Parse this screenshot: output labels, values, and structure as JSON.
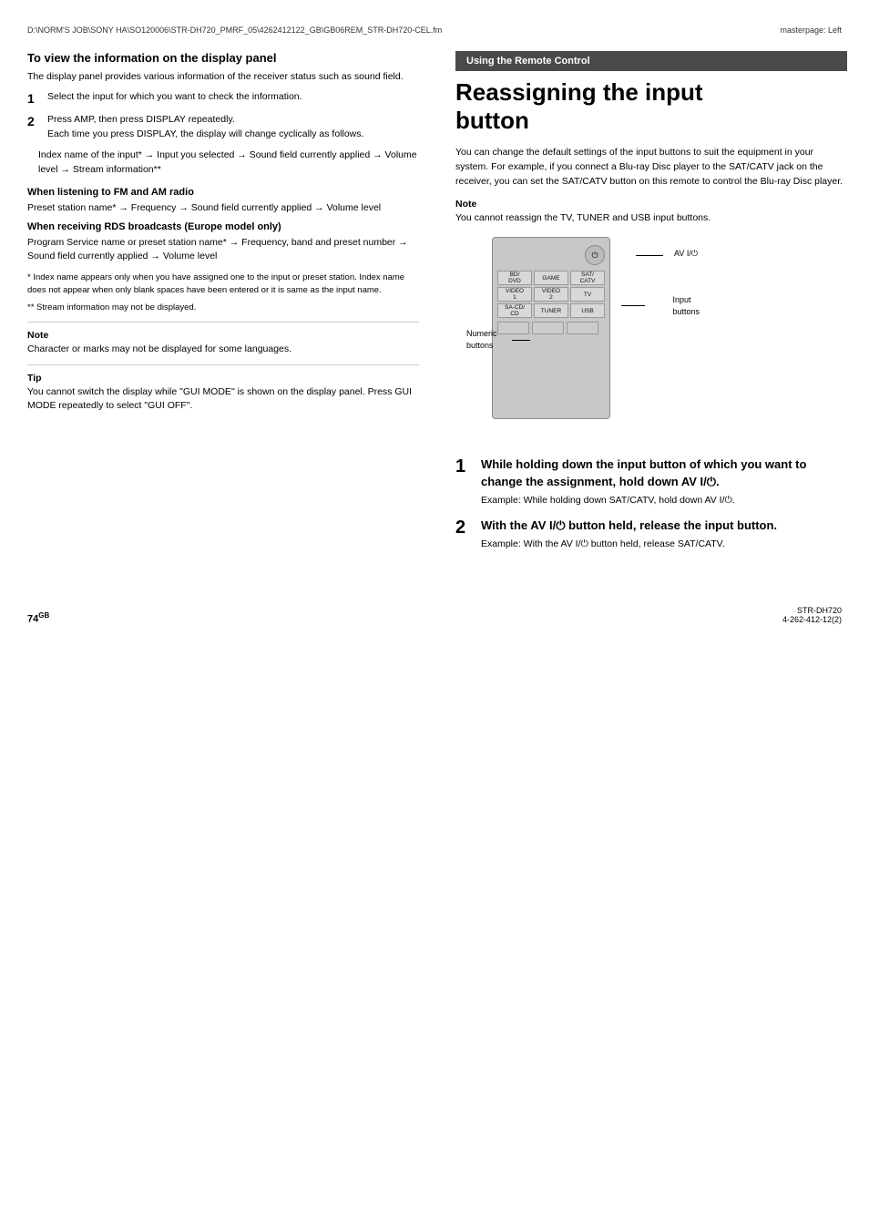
{
  "header": {
    "left_text": "D:\\NORM'S JOB\\SONY HA\\SO120006\\STR-DH720_PMRF_05\\4262412122_GB\\GB06REM_STR-DH720-CEL.fm",
    "right_text": "masterpage: Left"
  },
  "left_section": {
    "heading": "To view the information on the display panel",
    "intro": "The display panel provides various information of the receiver status such as sound field.",
    "steps": [
      {
        "num": "1",
        "text": "Select the input for which you want to check the information."
      },
      {
        "num": "2",
        "main_text": "Press AMP, then press DISPLAY repeatedly.",
        "sub_text": "Each time you press DISPLAY, the display will change cyclically as follows."
      }
    ],
    "flow_text": "Index name of the input* → Input you selected → Sound field currently applied → Volume level → Stream information**",
    "fm_am_heading": "When listening to FM and AM radio",
    "fm_am_text": "Preset station name* → Frequency → Sound field currently applied → Volume level",
    "rds_heading": "When receiving RDS broadcasts (Europe model only)",
    "rds_text": "Program Service name or preset station name* → Frequency, band and preset number → Sound field currently applied → Volume level",
    "footnote1": "* Index name appears only when you have assigned one to the input or preset station. Index name does not appear when only blank spaces have been entered or it is same as the input name.",
    "footnote2": "** Stream information may not be displayed.",
    "note_heading": "Note",
    "note_text": "Character or marks may not be displayed for some languages.",
    "tip_heading": "Tip",
    "tip_text": "You cannot switch the display while \"GUI MODE\" is shown on the display panel. Press GUI MODE repeatedly to select \"GUI OFF\"."
  },
  "right_section": {
    "banner": "Using the Remote Control",
    "heading_line1": "Reassigning the input",
    "heading_line2": "button",
    "intro": "You can change the default settings of the input buttons to suit the equipment in your system. For example, if you connect a Blu-ray Disc player to the SAT/CATV jack on the receiver, you can set the SAT/CATV button on this remote to control the Blu-ray Disc player.",
    "note_heading": "Note",
    "note_text": "You cannot reassign the TV, TUNER and USB input buttons.",
    "diagram": {
      "av_label": "AV I/⏻",
      "input_buttons_label": "Input\nbuttons",
      "numeric_buttons_label": "Numeric\nbuttons",
      "btn_row1": [
        "BD/DVD",
        "GAME",
        "SAT/\nCATV"
      ],
      "btn_row2": [
        "VIDEO\n1",
        "VIDEO\n2",
        "TV"
      ],
      "btn_row3": [
        "SA-CD/\nCD",
        "TUNER",
        "USB"
      ]
    },
    "steps": [
      {
        "num": "1",
        "main": "While holding down the input button of which you want to change the assignment, hold down AV I/⏻.",
        "example": "Example: While holding down SAT/CATV, hold down AV I/⏻."
      },
      {
        "num": "2",
        "main": "With the AV I/⏻ button held, release the input button.",
        "example": "Example: With the AV I/⏻ button held, release SAT/CATV."
      }
    ]
  },
  "footer": {
    "page_number": "74",
    "page_superscript": "GB",
    "model": "STR-DH720",
    "code": "4-262-412-12(2)"
  }
}
